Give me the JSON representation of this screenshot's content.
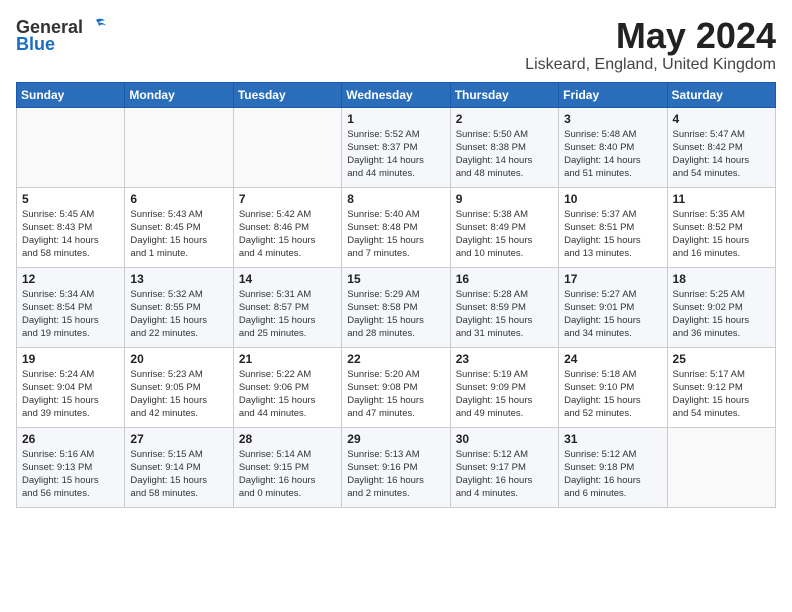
{
  "header": {
    "logo_general": "General",
    "logo_blue": "Blue",
    "title": "May 2024",
    "location": "Liskeard, England, United Kingdom"
  },
  "days_of_week": [
    "Sunday",
    "Monday",
    "Tuesday",
    "Wednesday",
    "Thursday",
    "Friday",
    "Saturday"
  ],
  "weeks": [
    [
      {
        "day": "",
        "detail": ""
      },
      {
        "day": "",
        "detail": ""
      },
      {
        "day": "",
        "detail": ""
      },
      {
        "day": "1",
        "detail": "Sunrise: 5:52 AM\nSunset: 8:37 PM\nDaylight: 14 hours\nand 44 minutes."
      },
      {
        "day": "2",
        "detail": "Sunrise: 5:50 AM\nSunset: 8:38 PM\nDaylight: 14 hours\nand 48 minutes."
      },
      {
        "day": "3",
        "detail": "Sunrise: 5:48 AM\nSunset: 8:40 PM\nDaylight: 14 hours\nand 51 minutes."
      },
      {
        "day": "4",
        "detail": "Sunrise: 5:47 AM\nSunset: 8:42 PM\nDaylight: 14 hours\nand 54 minutes."
      }
    ],
    [
      {
        "day": "5",
        "detail": "Sunrise: 5:45 AM\nSunset: 8:43 PM\nDaylight: 14 hours\nand 58 minutes."
      },
      {
        "day": "6",
        "detail": "Sunrise: 5:43 AM\nSunset: 8:45 PM\nDaylight: 15 hours\nand 1 minute."
      },
      {
        "day": "7",
        "detail": "Sunrise: 5:42 AM\nSunset: 8:46 PM\nDaylight: 15 hours\nand 4 minutes."
      },
      {
        "day": "8",
        "detail": "Sunrise: 5:40 AM\nSunset: 8:48 PM\nDaylight: 15 hours\nand 7 minutes."
      },
      {
        "day": "9",
        "detail": "Sunrise: 5:38 AM\nSunset: 8:49 PM\nDaylight: 15 hours\nand 10 minutes."
      },
      {
        "day": "10",
        "detail": "Sunrise: 5:37 AM\nSunset: 8:51 PM\nDaylight: 15 hours\nand 13 minutes."
      },
      {
        "day": "11",
        "detail": "Sunrise: 5:35 AM\nSunset: 8:52 PM\nDaylight: 15 hours\nand 16 minutes."
      }
    ],
    [
      {
        "day": "12",
        "detail": "Sunrise: 5:34 AM\nSunset: 8:54 PM\nDaylight: 15 hours\nand 19 minutes."
      },
      {
        "day": "13",
        "detail": "Sunrise: 5:32 AM\nSunset: 8:55 PM\nDaylight: 15 hours\nand 22 minutes."
      },
      {
        "day": "14",
        "detail": "Sunrise: 5:31 AM\nSunset: 8:57 PM\nDaylight: 15 hours\nand 25 minutes."
      },
      {
        "day": "15",
        "detail": "Sunrise: 5:29 AM\nSunset: 8:58 PM\nDaylight: 15 hours\nand 28 minutes."
      },
      {
        "day": "16",
        "detail": "Sunrise: 5:28 AM\nSunset: 8:59 PM\nDaylight: 15 hours\nand 31 minutes."
      },
      {
        "day": "17",
        "detail": "Sunrise: 5:27 AM\nSunset: 9:01 PM\nDaylight: 15 hours\nand 34 minutes."
      },
      {
        "day": "18",
        "detail": "Sunrise: 5:25 AM\nSunset: 9:02 PM\nDaylight: 15 hours\nand 36 minutes."
      }
    ],
    [
      {
        "day": "19",
        "detail": "Sunrise: 5:24 AM\nSunset: 9:04 PM\nDaylight: 15 hours\nand 39 minutes."
      },
      {
        "day": "20",
        "detail": "Sunrise: 5:23 AM\nSunset: 9:05 PM\nDaylight: 15 hours\nand 42 minutes."
      },
      {
        "day": "21",
        "detail": "Sunrise: 5:22 AM\nSunset: 9:06 PM\nDaylight: 15 hours\nand 44 minutes."
      },
      {
        "day": "22",
        "detail": "Sunrise: 5:20 AM\nSunset: 9:08 PM\nDaylight: 15 hours\nand 47 minutes."
      },
      {
        "day": "23",
        "detail": "Sunrise: 5:19 AM\nSunset: 9:09 PM\nDaylight: 15 hours\nand 49 minutes."
      },
      {
        "day": "24",
        "detail": "Sunrise: 5:18 AM\nSunset: 9:10 PM\nDaylight: 15 hours\nand 52 minutes."
      },
      {
        "day": "25",
        "detail": "Sunrise: 5:17 AM\nSunset: 9:12 PM\nDaylight: 15 hours\nand 54 minutes."
      }
    ],
    [
      {
        "day": "26",
        "detail": "Sunrise: 5:16 AM\nSunset: 9:13 PM\nDaylight: 15 hours\nand 56 minutes."
      },
      {
        "day": "27",
        "detail": "Sunrise: 5:15 AM\nSunset: 9:14 PM\nDaylight: 15 hours\nand 58 minutes."
      },
      {
        "day": "28",
        "detail": "Sunrise: 5:14 AM\nSunset: 9:15 PM\nDaylight: 16 hours\nand 0 minutes."
      },
      {
        "day": "29",
        "detail": "Sunrise: 5:13 AM\nSunset: 9:16 PM\nDaylight: 16 hours\nand 2 minutes."
      },
      {
        "day": "30",
        "detail": "Sunrise: 5:12 AM\nSunset: 9:17 PM\nDaylight: 16 hours\nand 4 minutes."
      },
      {
        "day": "31",
        "detail": "Sunrise: 5:12 AM\nSunset: 9:18 PM\nDaylight: 16 hours\nand 6 minutes."
      },
      {
        "day": "",
        "detail": ""
      }
    ]
  ]
}
